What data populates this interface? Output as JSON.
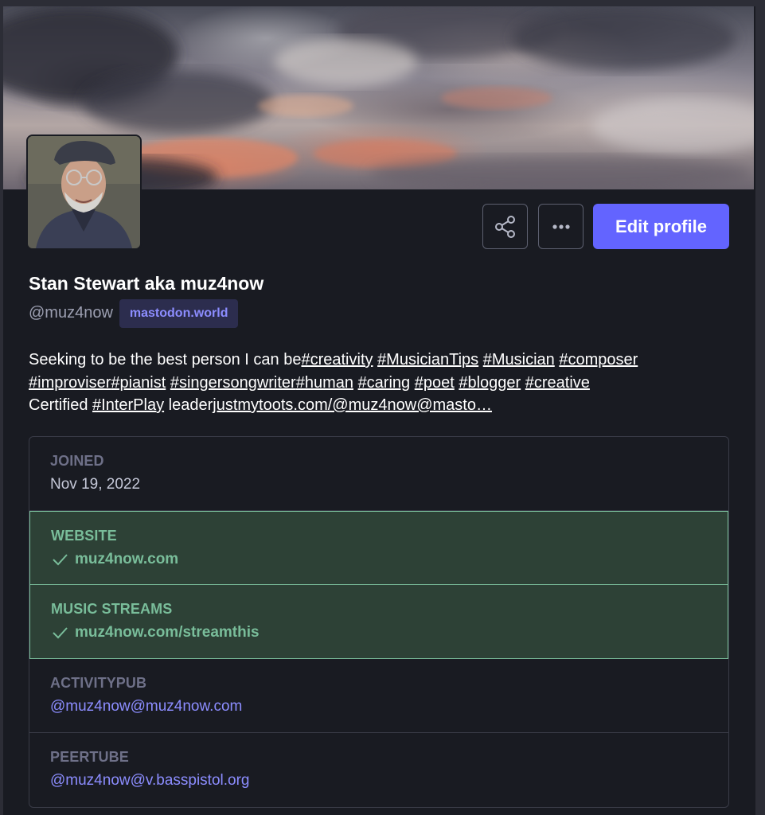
{
  "profile": {
    "display_name": "Stan Stewart aka muz4now",
    "username": "@muz4now",
    "server": "mastodon.world",
    "edit_label": "Edit profile",
    "share_icon": "share-icon",
    "more_icon": "more-icon"
  },
  "bio": {
    "line1_text": "Seeking to be the best person I can be",
    "tags1": [
      "#creativity",
      "#MusicianTips",
      "#Musician",
      "#composer"
    ],
    "tags2": [
      "#improviser",
      "#pianist",
      "#singersongwriter",
      "#human",
      "#caring",
      "#poet",
      "#blogger",
      "#creative"
    ],
    "line3_prefix": "Certified ",
    "line3_tag": "#InterPlay",
    "line3_mid": " leader",
    "line3_link": "justmytoots.com/@muz4now@masto…"
  },
  "fields": [
    {
      "name": "JOINED",
      "value": "Nov 19, 2022"
    },
    {
      "name": "WEBSITE",
      "value": "muz4now.com"
    },
    {
      "name": "MUSIC STREAMS",
      "value": "muz4now.com/streamthis"
    },
    {
      "name": "ACTIVITYPUB",
      "value": "@muz4now@muz4now.com"
    },
    {
      "name": "PEERTUBE",
      "value": "@muz4now@v.basspistol.org"
    }
  ],
  "colors": {
    "accent": "#6364ff",
    "verified": "#79bd9a",
    "background": "#191b22"
  }
}
